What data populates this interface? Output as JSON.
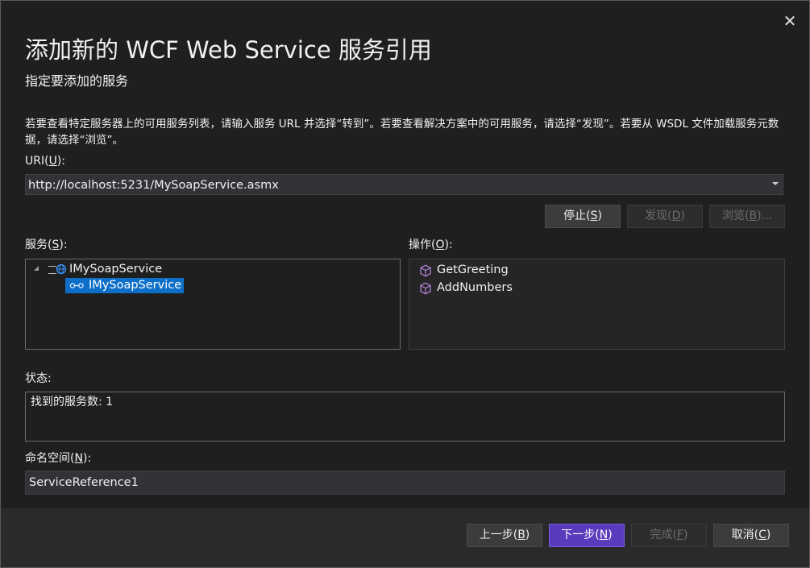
{
  "dialog": {
    "title": "添加新的 WCF Web Service 服务引用",
    "subtitle": "指定要添加的服务",
    "close_glyph": "✕",
    "description": "若要查看特定服务器上的可用服务列表，请输入服务 URL 并选择“转到”。若要查看解决方案中的可用服务，请选择“发现”。若要从 WSDL 文件加载服务元数据，请选择“浏览”。"
  },
  "uri": {
    "label": "URI(",
    "label_key": "U",
    "label_end": "):",
    "value": "http://localhost:5231/MySoapService.asmx"
  },
  "actions": {
    "stop": {
      "label": "停止(",
      "key": "S",
      "end": ")"
    },
    "discover": {
      "label": "发现(",
      "key": "D",
      "end": ")"
    },
    "browse": {
      "label": "浏览(",
      "key": "B",
      "end": ")..."
    }
  },
  "services": {
    "label": "服务(",
    "label_key": "S",
    "label_end": "):",
    "tree": {
      "root": "IMySoapService",
      "child": "IMySoapService"
    }
  },
  "operations": {
    "label": "操作(",
    "label_key": "O",
    "label_end": "):",
    "items": [
      "GetGreeting",
      "AddNumbers"
    ]
  },
  "status": {
    "label": "状态:",
    "text": "找到的服务数: 1"
  },
  "namespace": {
    "label": "命名空间(",
    "label_key": "N",
    "label_end": "):",
    "value": "ServiceReference1"
  },
  "footer": {
    "prev": {
      "label": "上一步(",
      "key": "B",
      "end": ")"
    },
    "next": {
      "label": "下一步(",
      "key": "N",
      "end": ")"
    },
    "finish": {
      "label": "完成(",
      "key": "F",
      "end": ")"
    },
    "cancel": {
      "label": "取消(",
      "key": "C",
      "end": ")"
    }
  },
  "icons": {
    "close": "close-icon",
    "expand": "collapse-triangle-icon",
    "service": "globe-service-icon",
    "endpoint": "endpoint-icon",
    "operation": "cube-icon",
    "dropdown": "chevron-down-icon"
  },
  "colors": {
    "accent": "#5b3bbd",
    "selection": "#0e6fc9",
    "operation_icon": "#b180d7",
    "service_icon": "#3794ff"
  }
}
